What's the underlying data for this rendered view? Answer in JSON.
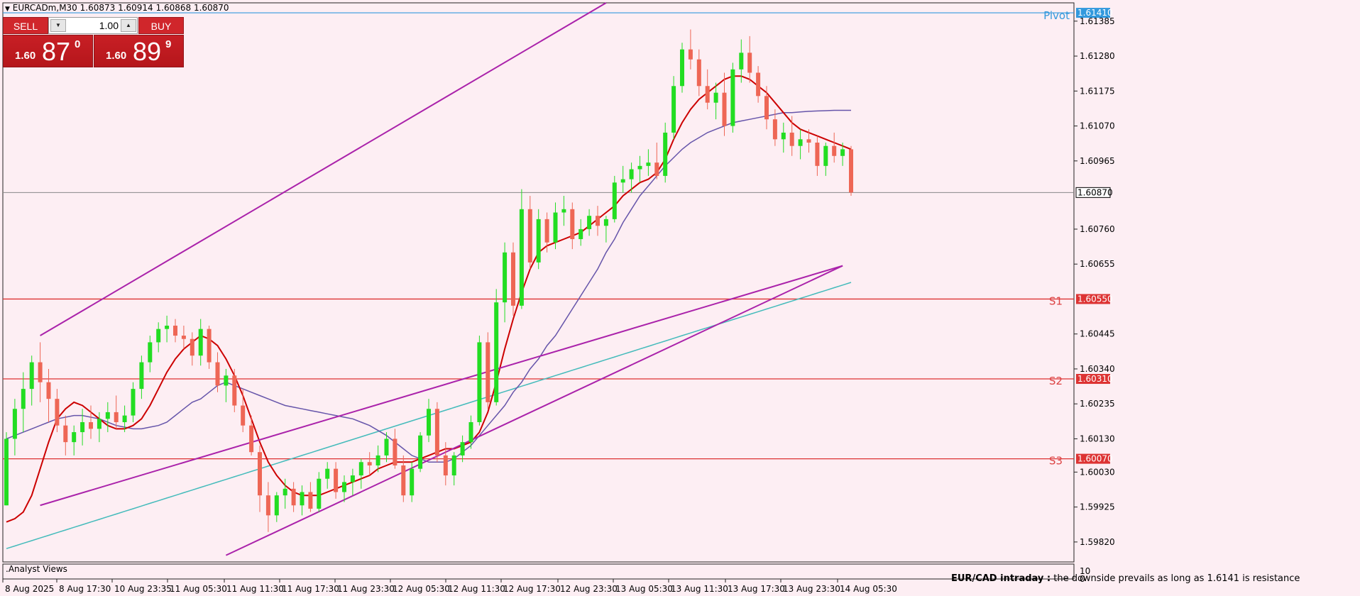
{
  "header": {
    "symbol_title": "EURCADm,M30  1.60873 1.60914 1.60868 1.60870",
    "triangle_icon": "triangle-down-icon"
  },
  "trade_panel": {
    "sell_label": "SELL",
    "buy_label": "BUY",
    "lot_value": "1.00",
    "sell_price": {
      "small": "1.60",
      "big": "87",
      "sup": "0"
    },
    "buy_price": {
      "small": "1.60",
      "big": "89",
      "sup": "9"
    }
  },
  "price_axis": {
    "ticks": [
      "1.61385",
      "1.61280",
      "1.61175",
      "1.61070",
      "1.60965",
      "1.60760",
      "1.60655",
      "1.60445",
      "1.60340",
      "1.60235",
      "1.60130",
      "1.60030",
      "1.59925",
      "1.59820"
    ],
    "current_price": "1.60870",
    "pivot_price": "1.61410",
    "s1_price": "1.60550",
    "s2_price": "1.60310",
    "s3_price": "1.60070"
  },
  "level_labels": {
    "pivot": "Pivot",
    "s1": "S1",
    "s2": "S2",
    "s3": "S3"
  },
  "time_axis": {
    "labels": [
      "8 Aug 2025",
      "8 Aug 17:30",
      "10 Aug 23:35",
      "11 Aug 05:30",
      "11 Aug 11:30",
      "11 Aug 17:30",
      "11 Aug 23:30",
      "12 Aug 05:30",
      "12 Aug 11:30",
      "12 Aug 17:30",
      "12 Aug 23:30",
      "13 Aug 05:30",
      "13 Aug 11:30",
      "13 Aug 17:30",
      "13 Aug 23:30",
      "14 Aug 05:30"
    ]
  },
  "indicator_panel": {
    "title": ".Analyst Views",
    "scale_max": "10",
    "scale_min": "0",
    "commentary_bold": "EUR/CAD intraday :",
    "commentary_text": "the downside prevails as long as 1.6141 is resistance"
  },
  "colors": {
    "background": "#fdeef3",
    "bull": "#22dd22",
    "bear": "#ee6655",
    "ma_red": "#cc0000",
    "ma_blue": "#6655aa",
    "ma_cyan": "#44bbbb",
    "channel": "#aa22aa",
    "level_line": "#dd3333",
    "pivot_color": "#3399dd"
  },
  "chart_data": {
    "type": "candlestick",
    "y_range": [
      1.5976,
      1.6144
    ],
    "candles_ohlc": [
      [
        1.5993,
        1.6015,
        1.5993,
        1.6013
      ],
      [
        1.6013,
        1.6025,
        1.6008,
        1.6022
      ],
      [
        1.6022,
        1.6033,
        1.6015,
        1.6028
      ],
      [
        1.6028,
        1.6038,
        1.6023,
        1.6036
      ],
      [
        1.6036,
        1.6042,
        1.6024,
        1.603
      ],
      [
        1.603,
        1.6034,
        1.6018,
        1.6025
      ],
      [
        1.6025,
        1.6028,
        1.6015,
        1.6017
      ],
      [
        1.6017,
        1.602,
        1.6008,
        1.6012
      ],
      [
        1.6012,
        1.6017,
        1.6008,
        1.6015
      ],
      [
        1.6015,
        1.6022,
        1.6011,
        1.6018
      ],
      [
        1.6018,
        1.6023,
        1.6013,
        1.6016
      ],
      [
        1.6016,
        1.6021,
        1.6012,
        1.6019
      ],
      [
        1.6019,
        1.6024,
        1.6015,
        1.6021
      ],
      [
        1.6021,
        1.6026,
        1.6016,
        1.6018
      ],
      [
        1.6018,
        1.6023,
        1.6015,
        1.602
      ],
      [
        1.602,
        1.603,
        1.6018,
        1.6028
      ],
      [
        1.6028,
        1.6038,
        1.6025,
        1.6036
      ],
      [
        1.6036,
        1.6044,
        1.6033,
        1.6042
      ],
      [
        1.6042,
        1.6048,
        1.6039,
        1.6046
      ],
      [
        1.6046,
        1.605,
        1.6042,
        1.6047
      ],
      [
        1.6047,
        1.6049,
        1.6042,
        1.6044
      ],
      [
        1.6044,
        1.6047,
        1.604,
        1.6043
      ],
      [
        1.6043,
        1.6045,
        1.6035,
        1.6038
      ],
      [
        1.6038,
        1.6049,
        1.6035,
        1.6046
      ],
      [
        1.6046,
        1.6047,
        1.6034,
        1.6036
      ],
      [
        1.6036,
        1.6039,
        1.6027,
        1.6029
      ],
      [
        1.6029,
        1.6034,
        1.6024,
        1.6032
      ],
      [
        1.6032,
        1.6034,
        1.6021,
        1.6023
      ],
      [
        1.6023,
        1.6028,
        1.6015,
        1.6017
      ],
      [
        1.6017,
        1.602,
        1.6008,
        1.6009
      ],
      [
        1.6009,
        1.6011,
        1.5991,
        1.5996
      ],
      [
        1.5996,
        1.6,
        1.5985,
        1.599
      ],
      [
        1.599,
        1.5997,
        1.5988,
        1.5996
      ],
      [
        1.5996,
        1.6001,
        1.5992,
        1.5998
      ],
      [
        1.5998,
        1.6,
        1.5991,
        1.5993
      ],
      [
        1.5993,
        1.5999,
        1.599,
        1.5997
      ],
      [
        1.5997,
        1.6,
        1.5991,
        1.5992
      ],
      [
        1.5992,
        1.6003,
        1.5991,
        1.6001
      ],
      [
        1.6001,
        1.6006,
        1.5998,
        1.6004
      ],
      [
        1.6004,
        1.6006,
        1.5995,
        1.5997
      ],
      [
        1.5997,
        1.6002,
        1.5994,
        1.6
      ],
      [
        1.6,
        1.6004,
        1.5996,
        1.6002
      ],
      [
        1.6002,
        1.6007,
        1.5998,
        1.6006
      ],
      [
        1.6006,
        1.6009,
        1.6002,
        1.6005
      ],
      [
        1.6005,
        1.6011,
        1.6003,
        1.6008
      ],
      [
        1.6008,
        1.6015,
        1.6006,
        1.6013
      ],
      [
        1.6013,
        1.6016,
        1.6004,
        1.6005
      ],
      [
        1.6005,
        1.6008,
        1.5994,
        1.5996
      ],
      [
        1.5996,
        1.6006,
        1.5994,
        1.6004
      ],
      [
        1.6004,
        1.6015,
        1.6003,
        1.6014
      ],
      [
        1.6014,
        1.6025,
        1.6012,
        1.6022
      ],
      [
        1.6022,
        1.6024,
        1.6006,
        1.6008
      ],
      [
        1.6008,
        1.6012,
        1.5999,
        1.6002
      ],
      [
        1.6002,
        1.6009,
        1.5999,
        1.6008
      ],
      [
        1.6008,
        1.6014,
        1.6006,
        1.6012
      ],
      [
        1.6012,
        1.602,
        1.601,
        1.6018
      ],
      [
        1.6018,
        1.6044,
        1.6017,
        1.6042
      ],
      [
        1.6042,
        1.6045,
        1.6022,
        1.6024
      ],
      [
        1.6024,
        1.6058,
        1.6023,
        1.6054
      ],
      [
        1.6054,
        1.6072,
        1.6048,
        1.6069
      ],
      [
        1.6069,
        1.6072,
        1.605,
        1.6053
      ],
      [
        1.6053,
        1.6088,
        1.6052,
        1.6082
      ],
      [
        1.6082,
        1.6086,
        1.6064,
        1.6066
      ],
      [
        1.6066,
        1.6082,
        1.6064,
        1.6079
      ],
      [
        1.6079,
        1.6081,
        1.6069,
        1.6072
      ],
      [
        1.6072,
        1.6084,
        1.607,
        1.6081
      ],
      [
        1.6081,
        1.6086,
        1.6077,
        1.6082
      ],
      [
        1.6082,
        1.6084,
        1.607,
        1.6073
      ],
      [
        1.6073,
        1.6079,
        1.6071,
        1.6076
      ],
      [
        1.6076,
        1.6082,
        1.6074,
        1.608
      ],
      [
        1.608,
        1.6083,
        1.6074,
        1.6077
      ],
      [
        1.6077,
        1.608,
        1.6072,
        1.6079
      ],
      [
        1.6079,
        1.6092,
        1.6078,
        1.609
      ],
      [
        1.609,
        1.6095,
        1.6087,
        1.6091
      ],
      [
        1.6091,
        1.6096,
        1.6087,
        1.6094
      ],
      [
        1.6094,
        1.6098,
        1.609,
        1.6095
      ],
      [
        1.6095,
        1.61,
        1.6092,
        1.6096
      ],
      [
        1.6096,
        1.6102,
        1.6091,
        1.6092
      ],
      [
        1.6092,
        1.6108,
        1.609,
        1.6105
      ],
      [
        1.6105,
        1.6122,
        1.6103,
        1.6119
      ],
      [
        1.6119,
        1.6132,
        1.6117,
        1.613
      ],
      [
        1.613,
        1.6136,
        1.6124,
        1.6127
      ],
      [
        1.6127,
        1.613,
        1.6116,
        1.6119
      ],
      [
        1.6119,
        1.6124,
        1.6112,
        1.6114
      ],
      [
        1.6114,
        1.612,
        1.6109,
        1.6117
      ],
      [
        1.6117,
        1.6123,
        1.6104,
        1.6107
      ],
      [
        1.6107,
        1.6126,
        1.6105,
        1.6124
      ],
      [
        1.6124,
        1.6133,
        1.612,
        1.6129
      ],
      [
        1.6129,
        1.6134,
        1.612,
        1.6123
      ],
      [
        1.6123,
        1.6125,
        1.6114,
        1.6116
      ],
      [
        1.6116,
        1.6119,
        1.6106,
        1.6109
      ],
      [
        1.6109,
        1.6112,
        1.6101,
        1.6103
      ],
      [
        1.6103,
        1.6108,
        1.6099,
        1.6105
      ],
      [
        1.6105,
        1.611,
        1.6098,
        1.6101
      ],
      [
        1.6101,
        1.6106,
        1.6097,
        1.6103
      ],
      [
        1.6103,
        1.6106,
        1.6099,
        1.6102
      ],
      [
        1.6102,
        1.6104,
        1.6092,
        1.6095
      ],
      [
        1.6095,
        1.6102,
        1.6092,
        1.6101
      ],
      [
        1.6101,
        1.6105,
        1.6096,
        1.6098
      ],
      [
        1.6098,
        1.6102,
        1.6095,
        1.61
      ],
      [
        1.61,
        1.6101,
        1.6086,
        1.6087
      ]
    ],
    "ma_red": [
      1.5988,
      1.5989,
      1.5991,
      1.5996,
      1.6004,
      1.6012,
      1.6019,
      1.6022,
      1.6024,
      1.6023,
      1.6021,
      1.6019,
      1.6017,
      1.6016,
      1.6016,
      1.6017,
      1.6019,
      1.6023,
      1.6028,
      1.6033,
      1.6037,
      1.604,
      1.6042,
      1.6044,
      1.6043,
      1.6041,
      1.6037,
      1.6032,
      1.6026,
      1.6019,
      1.6012,
      1.6006,
      1.6002,
      1.5999,
      1.5997,
      1.5996,
      1.5996,
      1.5996,
      1.5997,
      1.5998,
      1.5999,
      1.6,
      1.6001,
      1.6002,
      1.6004,
      1.6005,
      1.6006,
      1.6006,
      1.6006,
      1.6007,
      1.6008,
      1.6009,
      1.601,
      1.601,
      1.6011,
      1.6012,
      1.6015,
      1.6021,
      1.603,
      1.604,
      1.6049,
      1.6057,
      1.6064,
      1.6069,
      1.6071,
      1.6072,
      1.6073,
      1.6074,
      1.6075,
      1.6077,
      1.6079,
      1.6081,
      1.6083,
      1.6086,
      1.6088,
      1.609,
      1.6091,
      1.6093,
      1.6097,
      1.6103,
      1.6108,
      1.6112,
      1.6115,
      1.6117,
      1.6119,
      1.6121,
      1.6122,
      1.6122,
      1.6121,
      1.6119,
      1.6117,
      1.6114,
      1.6111,
      1.6108,
      1.6106,
      1.6105,
      1.6104,
      1.6103,
      1.6102,
      1.6101,
      1.61
    ],
    "ma_blue": [
      1.6013,
      1.6014,
      1.6015,
      1.6016,
      1.6017,
      1.6018,
      1.6019,
      1.60195,
      1.602,
      1.602,
      1.60195,
      1.6019,
      1.6018,
      1.6017,
      1.60165,
      1.6016,
      1.6016,
      1.60165,
      1.6017,
      1.6018,
      1.602,
      1.6022,
      1.6024,
      1.6025,
      1.6027,
      1.6029,
      1.603,
      1.6029,
      1.6028,
      1.6027,
      1.6026,
      1.6025,
      1.6024,
      1.6023,
      1.60225,
      1.6022,
      1.60215,
      1.6021,
      1.60205,
      1.602,
      1.60195,
      1.6019,
      1.6018,
      1.6017,
      1.60155,
      1.6014,
      1.6012,
      1.601,
      1.6008,
      1.6007,
      1.6006,
      1.6006,
      1.6006,
      1.6007,
      1.6009,
      1.6011,
      1.6014,
      1.6017,
      1.602,
      1.6023,
      1.6027,
      1.603,
      1.6034,
      1.6037,
      1.6041,
      1.6044,
      1.6048,
      1.6052,
      1.6056,
      1.606,
      1.6064,
      1.6069,
      1.6073,
      1.6078,
      1.6082,
      1.6086,
      1.6089,
      1.6092,
      1.6095,
      1.60975,
      1.61,
      1.6102,
      1.61035,
      1.6105,
      1.6106,
      1.6107,
      1.6108,
      1.61085,
      1.6109,
      1.61095,
      1.611,
      1.61105,
      1.6111,
      1.6111,
      1.61112,
      1.61114,
      1.61115,
      1.61116,
      1.61117,
      1.61117,
      1.61117
    ],
    "ma_cyan": [
      1.598,
      1.59808,
      1.59816,
      1.59824,
      1.59832,
      1.5984,
      1.59848,
      1.59856,
      1.59864,
      1.59872,
      1.5988,
      1.59888,
      1.59896,
      1.59904,
      1.59912,
      1.5992,
      1.59928,
      1.59936,
      1.59944,
      1.59952,
      1.5996,
      1.59968,
      1.59976,
      1.59984,
      1.59992,
      1.6,
      1.60008,
      1.60016,
      1.60024,
      1.60032,
      1.6004,
      1.60048,
      1.60056,
      1.60064,
      1.60072,
      1.6008,
      1.60088,
      1.60096,
      1.60104,
      1.60112,
      1.6012,
      1.60128,
      1.60136,
      1.60144,
      1.60152,
      1.6016,
      1.60168,
      1.60176,
      1.60184,
      1.60192,
      1.602,
      1.60208,
      1.60216,
      1.60224,
      1.60232,
      1.6024,
      1.60248,
      1.60256,
      1.60264,
      1.60272,
      1.6028,
      1.60288,
      1.60296,
      1.60304,
      1.60312,
      1.6032,
      1.60328,
      1.60336,
      1.60344,
      1.60352,
      1.6036,
      1.60368,
      1.60376,
      1.60384,
      1.60392,
      1.604,
      1.60408,
      1.60416,
      1.60424,
      1.60432,
      1.6044,
      1.60448,
      1.60456,
      1.60464,
      1.60472,
      1.6048,
      1.60488,
      1.60496,
      1.60504,
      1.60512,
      1.6052,
      1.60528,
      1.60536,
      1.60544,
      1.60552,
      1.6056,
      1.60568,
      1.60576,
      1.60584,
      1.60592,
      1.606
    ],
    "channel_lines": [
      {
        "from": [
          4,
          1.6044
        ],
        "to": [
          71,
          1.6144
        ]
      },
      {
        "from": [
          4,
          1.5993
        ],
        "to": [
          99,
          1.6065
        ]
      },
      {
        "from": [
          26,
          1.5978
        ],
        "to": [
          99,
          1.6065
        ]
      },
      {
        "from": [
          26,
          1.5978
        ],
        "to": [
          26,
          1.5978
        ]
      }
    ],
    "levels": {
      "pivot": 1.6141,
      "s1": 1.6055,
      "s2": 1.6031,
      "s3": 1.6007,
      "current": 1.6087
    }
  }
}
